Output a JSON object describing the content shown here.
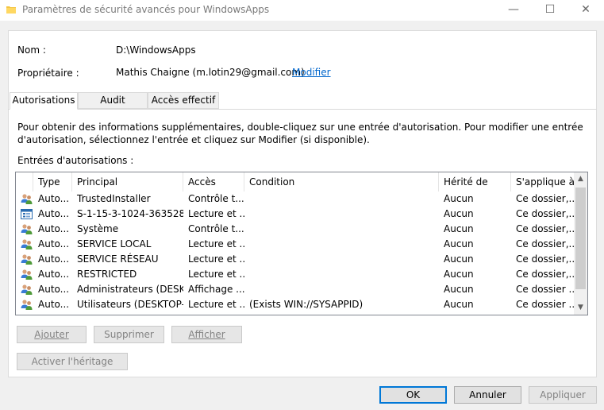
{
  "window": {
    "title": "Paramètres de sécurité avancés pour WindowsApps",
    "minimize": "—",
    "maximize": "☐",
    "close": "✕"
  },
  "info": {
    "name_label": "Nom :",
    "name_value": "D:\\WindowsApps",
    "owner_label": "Propriétaire :",
    "owner_value": "Mathis Chaigne (m.lotin29@gmail.com)",
    "owner_change": "Modifier"
  },
  "tabs": [
    {
      "label": "Autorisations"
    },
    {
      "label": "Audit"
    },
    {
      "label": "Accès effectif"
    }
  ],
  "description": "Pour obtenir des informations supplémentaires, double-cliquez sur une entrée d'autorisation. Pour modifier une entrée d'autorisation, sélectionnez l'entrée et cliquez sur Modifier (si disponible).",
  "entries_label": "Entrées d'autorisations :",
  "columns": [
    "Type",
    "Principal",
    "Accès",
    "Condition",
    "Hérité de",
    "S'applique à"
  ],
  "rows": [
    {
      "icon": "users",
      "type": "Auto...",
      "principal": "TrustedInstaller",
      "access": "Contrôle t...",
      "condition": "",
      "inherited": "Aucun",
      "applies": "Ce dossier,..."
    },
    {
      "icon": "app",
      "type": "Auto...",
      "principal": "S-1-15-3-1024-363528...",
      "access": "Lecture et ...",
      "condition": "",
      "inherited": "Aucun",
      "applies": "Ce dossier,..."
    },
    {
      "icon": "users",
      "type": "Auto...",
      "principal": "Système",
      "access": "Contrôle t...",
      "condition": "",
      "inherited": "Aucun",
      "applies": "Ce dossier,..."
    },
    {
      "icon": "users",
      "type": "Auto...",
      "principal": "SERVICE LOCAL",
      "access": "Lecture et ...",
      "condition": "",
      "inherited": "Aucun",
      "applies": "Ce dossier,..."
    },
    {
      "icon": "users",
      "type": "Auto...",
      "principal": "SERVICE RÉSEAU",
      "access": "Lecture et ...",
      "condition": "",
      "inherited": "Aucun",
      "applies": "Ce dossier,..."
    },
    {
      "icon": "users",
      "type": "Auto...",
      "principal": "RESTRICTED",
      "access": "Lecture et ...",
      "condition": "",
      "inherited": "Aucun",
      "applies": "Ce dossier,..."
    },
    {
      "icon": "users",
      "type": "Auto...",
      "principal": "Administrateurs (DESK...",
      "access": "Affichage ...",
      "condition": "",
      "inherited": "Aucun",
      "applies": "Ce dossier ..."
    },
    {
      "icon": "users",
      "type": "Auto...",
      "principal": "Utilisateurs (DESKTOP-...",
      "access": "Lecture et ...",
      "condition": "(Exists WIN://SYSAPPID)",
      "inherited": "Aucun",
      "applies": "Ce dossier ..."
    }
  ],
  "scroll": {
    "up": "▲",
    "down": "▼"
  },
  "buttons": {
    "add": "Ajouter",
    "remove": "Supprimer",
    "view": "Afficher",
    "enable_inheritance": "Activer l'héritage",
    "ok": "OK",
    "cancel": "Annuler",
    "apply": "Appliquer"
  }
}
